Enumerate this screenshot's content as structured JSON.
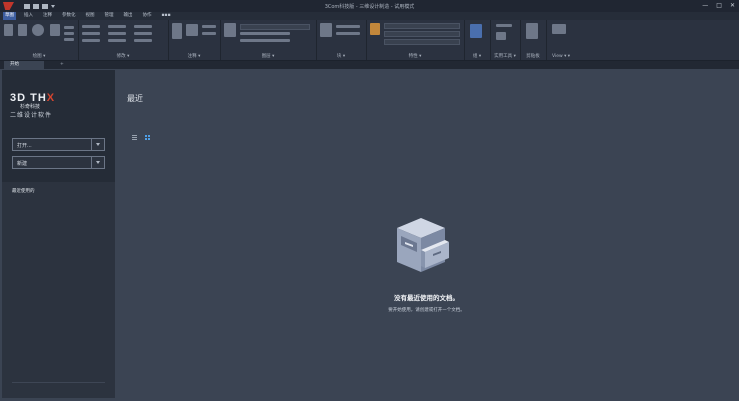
{
  "window": {
    "title": "3Com科技版 - 三维设计制造 - 试用模式",
    "controls": [
      "—",
      "□",
      "✕"
    ]
  },
  "quick_access": [
    "new-icon",
    "open-icon",
    "save-icon",
    "dropdown-icon"
  ],
  "menu": {
    "items": [
      "草图",
      "插入",
      "注释",
      "参数化",
      "视图",
      "管理",
      "输出",
      "协作",
      "▪▪▪"
    ]
  },
  "ribbon": {
    "groups": [
      "绘图 ▾",
      "修改 ▾",
      "注释 ▾",
      "图层 ▾",
      "块 ▾",
      "特性 ▾",
      "组 ▾",
      "实用工具 ▾",
      "剪贴板",
      "View ▾ ▾"
    ]
  },
  "tabs": {
    "start": "开始",
    "plus": "+"
  },
  "sidebar": {
    "brand": {
      "logo_text": "3D THX",
      "company": "杉奇科技",
      "product": "二维设计软件"
    },
    "open_label": "打开...",
    "new_label": "新建",
    "recent_link": "最近使用的"
  },
  "main": {
    "heading": "最近",
    "empty_title": "没有最近使用的文档。",
    "empty_subtitle": "要开始使用，请创建或打开一个文档。"
  }
}
